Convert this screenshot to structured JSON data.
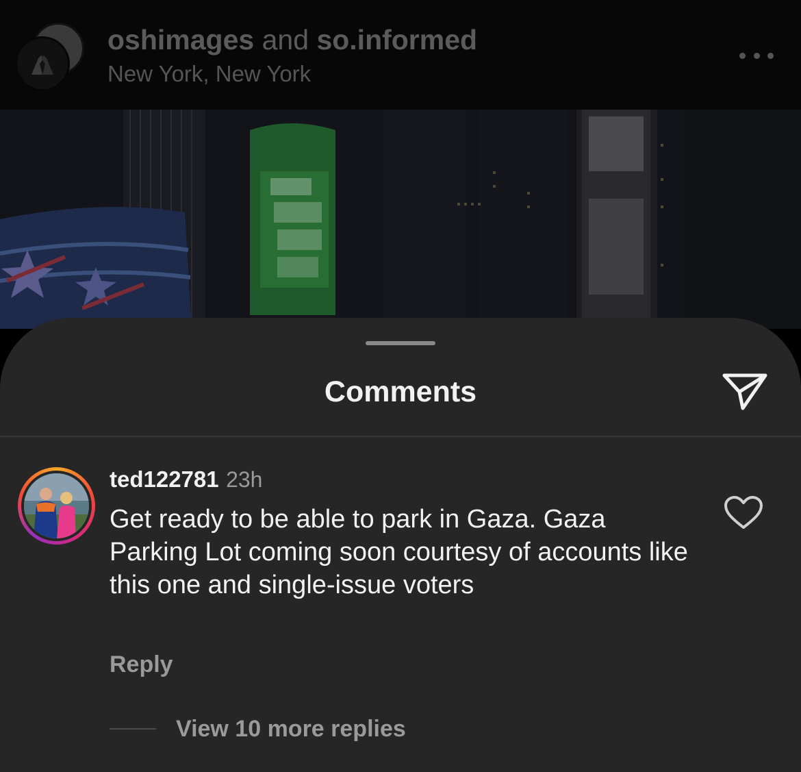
{
  "post": {
    "user1": "oshimages",
    "joiner": "and",
    "user2": "so.informed",
    "location": "New York, New York"
  },
  "sheet": {
    "title": "Comments"
  },
  "comment": {
    "username": "ted122781",
    "time": "23h",
    "text": "Get ready to be able to park in Gaza. Gaza Parking Lot coming soon courtesy of accounts like this one and single-issue voters",
    "reply_label": "Reply",
    "view_replies": "View 10 more replies"
  },
  "icons": {
    "more": "more-horizontal-icon",
    "share": "paper-plane-icon",
    "like": "heart-outline-icon"
  },
  "colors": {
    "sheet_bg": "#262626",
    "text_primary": "#f2f2f2",
    "text_secondary": "#9a9a9a"
  }
}
